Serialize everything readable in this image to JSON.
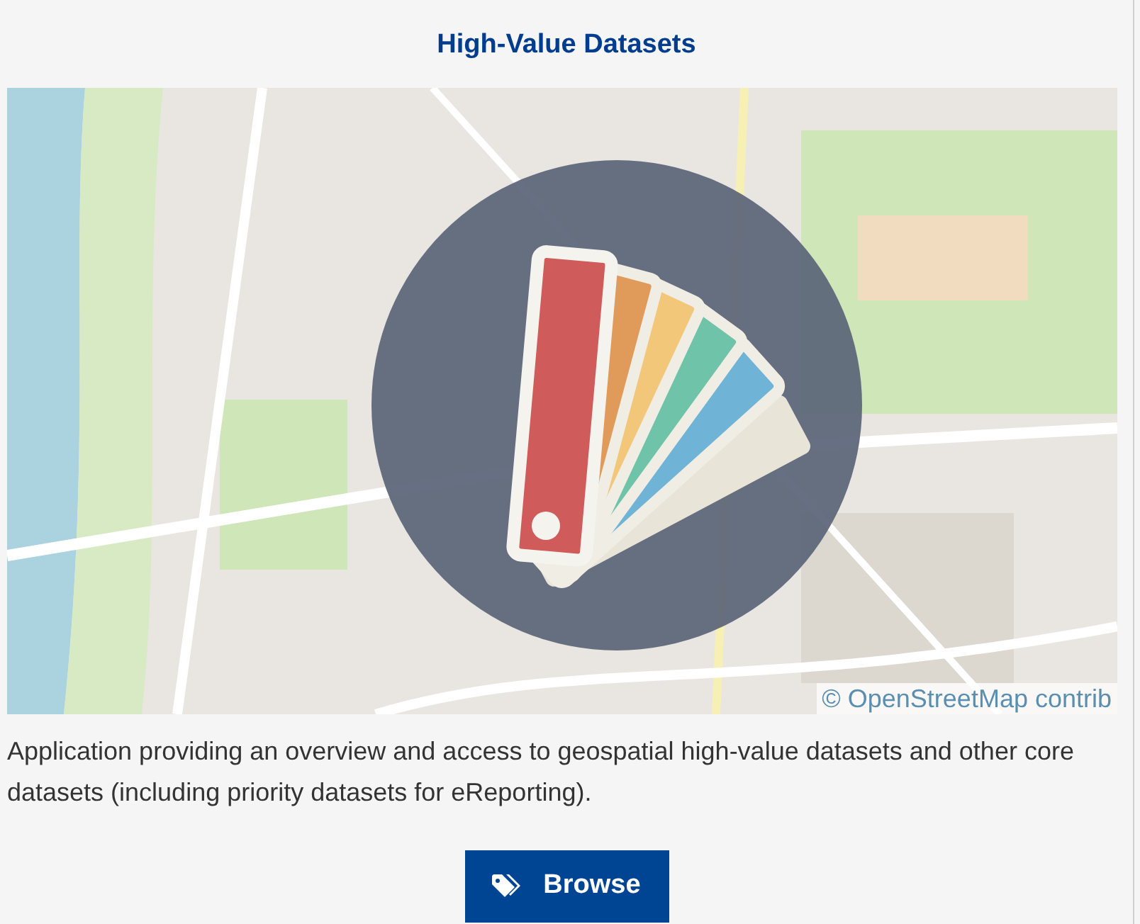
{
  "title": "High-Value Datasets",
  "map": {
    "attribution": "© OpenStreetMap contrib"
  },
  "description": "Application providing an overview and access to geospatial high-value datasets and other core datasets (including priority datasets for eReporting).",
  "button": {
    "label": "Browse"
  }
}
